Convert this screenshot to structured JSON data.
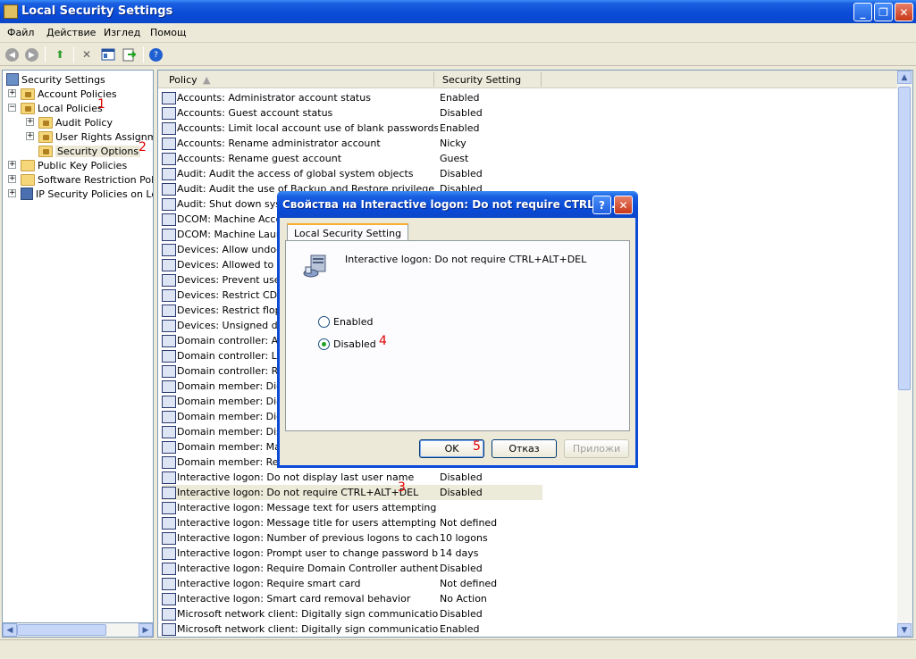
{
  "window": {
    "title": "Local Security Settings",
    "minimize": "_",
    "maximize": "❐",
    "close": "✕"
  },
  "menu": [
    "Файл",
    "Действие",
    "Изглед",
    "Помощ"
  ],
  "toolbar": {
    "icons": [
      "back-icon",
      "forward-icon",
      "up-folder-icon",
      "delete-icon",
      "properties-icon",
      "export-icon",
      "help-icon"
    ],
    "help_glyph": "?"
  },
  "tree": {
    "items": [
      {
        "label": "Security Settings"
      },
      {
        "label": "Account Policies"
      },
      {
        "label": "Local Policies",
        "annotation": "1"
      },
      {
        "label": "Audit Policy"
      },
      {
        "label": "User Rights Assignment"
      },
      {
        "label": "Security Options",
        "annotation": "2"
      },
      {
        "label": "Public Key Policies"
      },
      {
        "label": "Software Restriction Policies"
      },
      {
        "label": "IP Security Policies on Local Computer"
      }
    ]
  },
  "list": {
    "columns": [
      "Policy",
      "Security Setting"
    ],
    "rows": [
      {
        "policy": "Accounts: Administrator account status",
        "setting": "Enabled"
      },
      {
        "policy": "Accounts: Guest account status",
        "setting": "Disabled"
      },
      {
        "policy": "Accounts: Limit local account use of blank passwords to c...",
        "setting": "Enabled"
      },
      {
        "policy": "Accounts: Rename administrator account",
        "setting": "Nicky"
      },
      {
        "policy": "Accounts: Rename guest account",
        "setting": "Guest"
      },
      {
        "policy": "Audit: Audit the access of global system objects",
        "setting": "Disabled"
      },
      {
        "policy": "Audit: Audit the use of Backup and Restore privilege",
        "setting": "Disabled"
      },
      {
        "policy": "Audit: Shut down syste",
        "setting": ""
      },
      {
        "policy": "DCOM: Machine Access",
        "setting": ""
      },
      {
        "policy": "DCOM: Machine Launch",
        "setting": ""
      },
      {
        "policy": "Devices: Allow undock w",
        "setting": ""
      },
      {
        "policy": "Devices: Allowed to for",
        "setting": ""
      },
      {
        "policy": "Devices: Prevent users",
        "setting": ""
      },
      {
        "policy": "Devices: Restrict CD-RO",
        "setting": ""
      },
      {
        "policy": "Devices: Restrict floppy",
        "setting": ""
      },
      {
        "policy": "Devices: Unsigned drive",
        "setting": ""
      },
      {
        "policy": "Domain controller: Allow",
        "setting": ""
      },
      {
        "policy": "Domain controller: LDAP",
        "setting": ""
      },
      {
        "policy": "Domain controller: Refu",
        "setting": ""
      },
      {
        "policy": "Domain member: Digital",
        "setting": ""
      },
      {
        "policy": "Domain member: Digital",
        "setting": ""
      },
      {
        "policy": "Domain member: Digital",
        "setting": ""
      },
      {
        "policy": "Domain member: Disabl",
        "setting": ""
      },
      {
        "policy": "Domain member: Maxim",
        "setting": ""
      },
      {
        "policy": "Domain member: Requir",
        "setting": ""
      },
      {
        "policy": "Interactive logon: Do not display last user name",
        "setting": "Disabled"
      },
      {
        "policy": "Interactive logon: Do not require CTRL+ALT+DEL",
        "setting": "Disabled",
        "annotation": "3"
      },
      {
        "policy": "Interactive logon: Message text for users attempting to l...",
        "setting": ""
      },
      {
        "policy": "Interactive logon: Message title for users attempting to l...",
        "setting": "Not defined"
      },
      {
        "policy": "Interactive logon: Number of previous logons to cache (i...",
        "setting": "10 logons"
      },
      {
        "policy": "Interactive logon: Prompt user to change password befo...",
        "setting": "14 days"
      },
      {
        "policy": "Interactive logon: Require Domain Controller authenticat...",
        "setting": "Disabled"
      },
      {
        "policy": "Interactive logon: Require smart card",
        "setting": "Not defined"
      },
      {
        "policy": "Interactive logon: Smart card removal behavior",
        "setting": "No Action"
      },
      {
        "policy": "Microsoft network client: Digitally sign communications (al...",
        "setting": "Disabled"
      },
      {
        "policy": "Microsoft network client: Digitally sign communications (if...",
        "setting": "Enabled"
      }
    ]
  },
  "dialog": {
    "title": "Свойства на Interactive logon: Do not require CTRL+...",
    "help": "?",
    "close": "✕",
    "tab": "Local Security Setting",
    "description": "Interactive logon: Do not require CTRL+ALT+DEL",
    "options": [
      {
        "label": "Enabled",
        "checked": false
      },
      {
        "label": "Disabled",
        "checked": true,
        "annotation": "4"
      }
    ],
    "buttons": {
      "ok": "OK",
      "ok_annotation": "5",
      "cancel": "Отказ",
      "apply": "Приложи"
    }
  },
  "colors": {
    "titlebar": "#0a4bd8",
    "annotation": "#e00000"
  }
}
